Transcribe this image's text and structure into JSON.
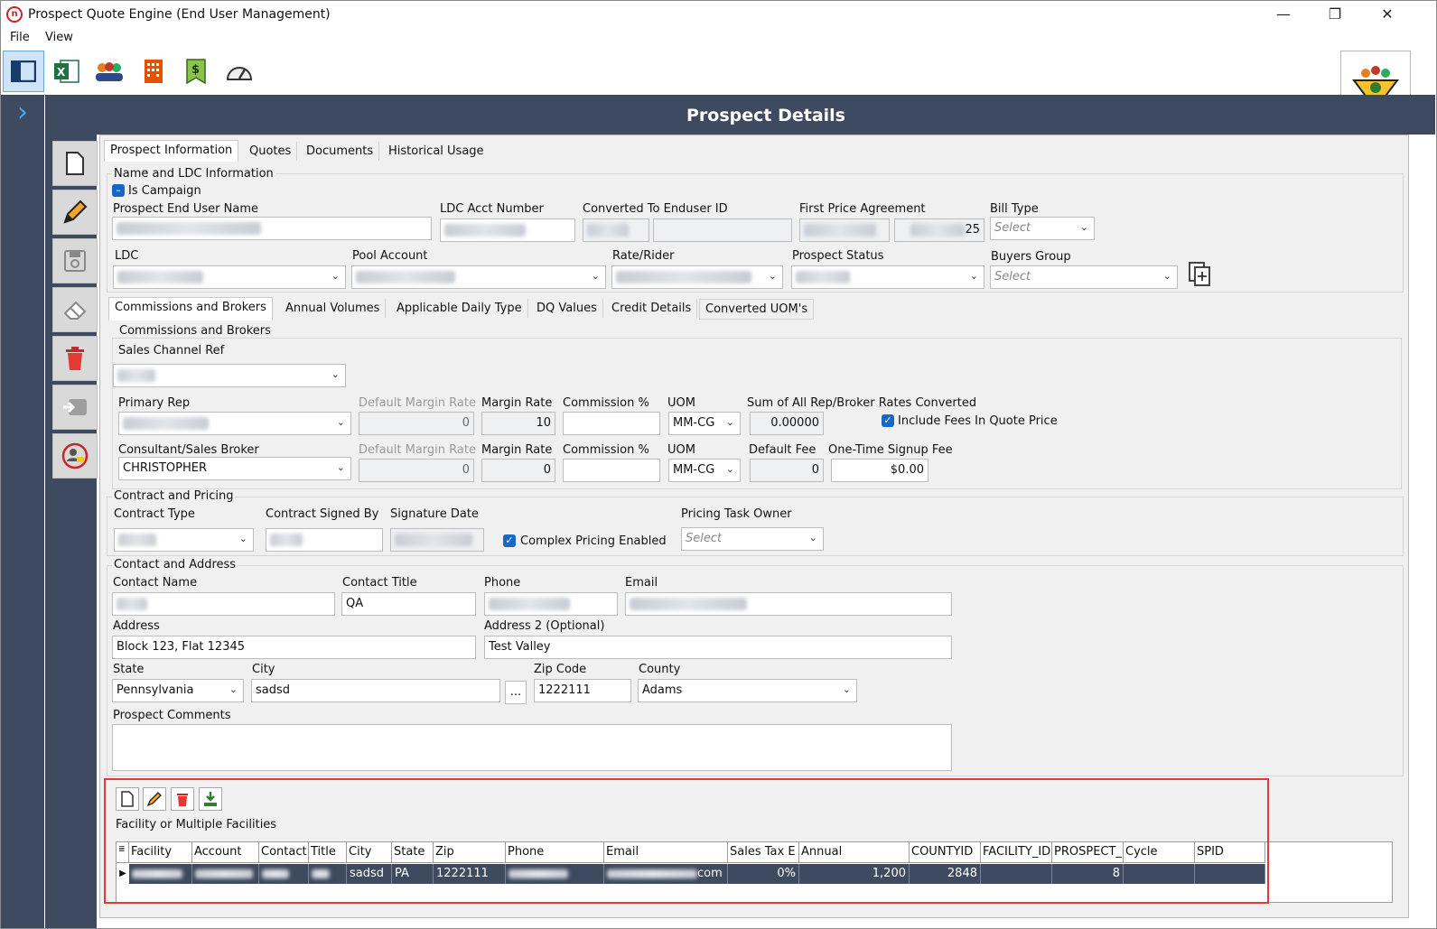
{
  "window": {
    "title": "Prospect Quote Engine (End User Management)"
  },
  "menu": {
    "file": "File",
    "view": "View"
  },
  "header": {
    "title": "Prospect Details"
  },
  "tabs": {
    "info": "Prospect Information",
    "quotes": "Quotes",
    "documents": "Documents",
    "history": "Historical Usage"
  },
  "ldc_section": {
    "title": "Name and LDC Information",
    "is_campaign": "Is Campaign",
    "end_user_name_label": "Prospect End User Name",
    "ldc_acct_label": "LDC Acct Number",
    "converted_label": "Converted To Enduser ID",
    "first_price_label": "First Price Agreement",
    "first_price_suffix": "25",
    "bill_type_label": "Bill Type",
    "ldc_label": "LDC",
    "pool_label": "Pool Account",
    "rate_label": "Rate/Rider",
    "status_label": "Prospect Status",
    "buyers_label": "Buyers Group",
    "select_placeholder": "Select"
  },
  "subtabs": {
    "commissions": "Commissions and Brokers",
    "annual": "Annual Volumes",
    "daily": "Applicable Daily Type",
    "dq": "DQ Values",
    "credit": "Credit Details",
    "uom": "Converted UOM's"
  },
  "commissions": {
    "title": "Commissions and Brokers",
    "sales_channel_label": "Sales Channel Ref",
    "primary_rep_label": "Primary Rep",
    "default_margin_label": "Default Margin Rate",
    "margin_label": "Margin Rate",
    "commission_label": "Commission %",
    "uom_label": "UOM",
    "sum_label": "Sum of All Rep/Broker Rates Converted",
    "include_fees": "Include Fees In Quote Price",
    "rep_default_margin": "0",
    "rep_margin": "10",
    "rep_uom": "MM-CG",
    "sum_value": "0.00000",
    "consultant_label": "Consultant/Sales Broker",
    "consultant_value": "CHRISTOPHER",
    "con_default_margin": "0",
    "con_margin": "0",
    "con_uom": "MM-CG",
    "default_fee_label": "Default Fee",
    "default_fee": "0",
    "signup_label": "One-Time Signup Fee",
    "signup_fee": "$0.00"
  },
  "contract": {
    "title": "Contract and Pricing",
    "type_label": "Contract Type",
    "signed_label": "Contract Signed By",
    "date_label": "Signature Date",
    "complex": "Complex Pricing Enabled",
    "owner_label": "Pricing Task Owner"
  },
  "contact": {
    "title": "Contact and Address",
    "name_label": "Contact Name",
    "title_label": "Contact Title",
    "title_value": "QA",
    "phone_label": "Phone",
    "email_label": "Email",
    "address_label": "Address",
    "address": "Block 123, Flat 12345",
    "address2_label": "Address 2 (Optional)",
    "address2": "Test Valley",
    "state_label": "State",
    "state": "Pennsylvania",
    "city_label": "City",
    "city": "sadsd",
    "ellipsis": "...",
    "zip_label": "Zip Code",
    "zip": "1222111",
    "county_label": "County",
    "county": "Adams",
    "comments_label": "Prospect Comments"
  },
  "facilities": {
    "title": "Facility or Multiple Facilities",
    "columns": [
      "Facility",
      "Account",
      "Contact",
      "Title",
      "City",
      "State",
      "Zip",
      "Phone",
      "Email",
      "Sales Tax E",
      "Annual",
      "COUNTYID",
      "FACILITY_ID",
      "PROSPECT_I",
      "Cycle",
      "SPID"
    ],
    "row": {
      "city": "sadsd",
      "state": "PA",
      "zip": "1222111",
      "email_tail": "com",
      "sales_tax": "0%",
      "annual": "1,200",
      "countyid": "2848",
      "prospect_tail": "8"
    }
  }
}
